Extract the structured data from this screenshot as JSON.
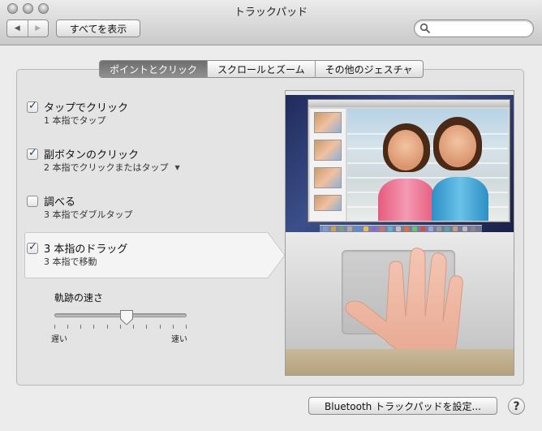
{
  "window": {
    "title": "トラックパッド"
  },
  "toolbar": {
    "back_icon": "back-arrow-icon",
    "forward_icon": "forward-arrow-icon",
    "back_glyph": "◀",
    "forward_glyph": "▶",
    "show_all_label": "すべてを表示",
    "search_placeholder": ""
  },
  "tabs": [
    {
      "label": "ポイントとクリック",
      "selected": true
    },
    {
      "label": "スクロールとズーム",
      "selected": false
    },
    {
      "label": "その他のジェスチャ",
      "selected": false
    }
  ],
  "options": [
    {
      "title": "タップでクリック",
      "subtitle": "1 本指でタップ",
      "checked": true
    },
    {
      "title": "副ボタンのクリック",
      "subtitle": "2 本指でクリックまたはタップ",
      "checked": true,
      "has_dropdown": true
    },
    {
      "title": "調べる",
      "subtitle": "3 本指でダブルタップ",
      "checked": false
    },
    {
      "title": "3 本指のドラッグ",
      "subtitle": "3 本指で移動",
      "checked": true,
      "selected": true
    }
  ],
  "tracking_speed": {
    "label": "軌跡の速さ",
    "min_label": "遅い",
    "max_label": "速い",
    "value_fraction": 0.5
  },
  "footer": {
    "bluetooth_button_label": "Bluetooth トラックパッドを設定...",
    "help_label": "?"
  },
  "colors": {
    "selected_tab": "#7a7a7a",
    "checkmark": "#1c3b66"
  }
}
